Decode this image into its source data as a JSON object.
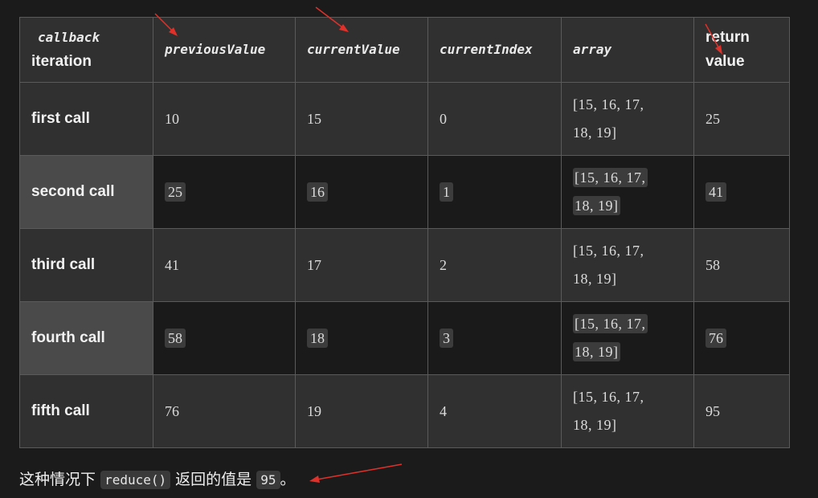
{
  "table": {
    "headers": {
      "col1_code": "callback",
      "col1_text": "iteration",
      "col2": "previousValue",
      "col3": "currentValue",
      "col4": "currentIndex",
      "col5": "array",
      "col6_line1": "return",
      "col6_line2": "value"
    },
    "rows": [
      {
        "label": "first call",
        "previousValue": "10",
        "currentValue": "15",
        "currentIndex": "0",
        "array_line1": "[15, 16, 17,",
        "array_line2": "18, 19]",
        "returnValue": "25"
      },
      {
        "label": "second call",
        "previousValue": "25",
        "currentValue": "16",
        "currentIndex": "1",
        "array_line1": "[15, 16, 17,",
        "array_line2": "18, 19]",
        "returnValue": "41"
      },
      {
        "label": "third call",
        "previousValue": "41",
        "currentValue": "17",
        "currentIndex": "2",
        "array_line1": "[15, 16, 17,",
        "array_line2": "18, 19]",
        "returnValue": "58"
      },
      {
        "label": "fourth call",
        "previousValue": "58",
        "currentValue": "18",
        "currentIndex": "3",
        "array_line1": "[15, 16, 17,",
        "array_line2": "18, 19]",
        "returnValue": "76"
      },
      {
        "label": "fifth call",
        "previousValue": "76",
        "currentValue": "19",
        "currentIndex": "4",
        "array_line1": "[15, 16, 17,",
        "array_line2": "18, 19]",
        "returnValue": "95"
      }
    ]
  },
  "footer": {
    "prefix": "这种情况下",
    "code1": "reduce()",
    "middle": "返回的值是",
    "code2": "95",
    "suffix": "。"
  },
  "annotation_color": "#e0302a"
}
